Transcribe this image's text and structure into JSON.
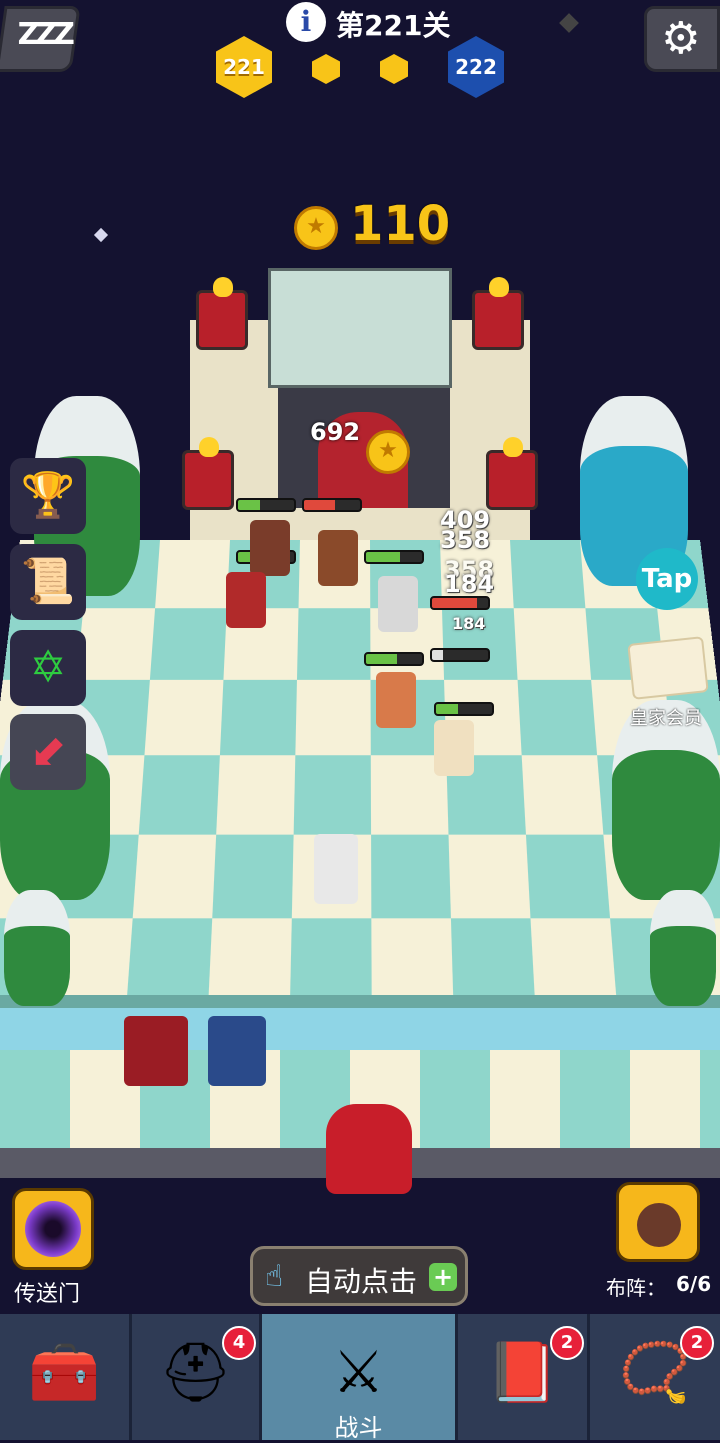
{
  "header": {
    "level_text": "第221关",
    "current_stage": "221",
    "next_stage": "222",
    "sleep_label": "ZZZ"
  },
  "battle": {
    "coin_total": "110",
    "gold_drop": "692",
    "damage_numbers": [
      "409",
      "358",
      "358",
      "184",
      "184"
    ]
  },
  "right_panel": {
    "tap_label": "Tap",
    "vip_label": "皇家会员"
  },
  "controls": {
    "portal_label": "传送门",
    "auto_click_label": "自动点击",
    "auto_click_plus": "+",
    "formation_label": "布阵：",
    "formation_count": "6/6"
  },
  "nav": {
    "tabs": [
      {
        "icon": "treasure-chest-icon",
        "badge": ""
      },
      {
        "icon": "viking-helmet-icon",
        "badge": "4"
      },
      {
        "icon": "crossed-swords-icon",
        "label": "战斗",
        "badge": ""
      },
      {
        "icon": "spellbook-icon",
        "badge": "2"
      },
      {
        "icon": "amulet-icon",
        "badge": "2"
      }
    ]
  },
  "colors": {
    "background": "#141230",
    "gold": "#f8c418",
    "teal_tile": "#8fd6cb",
    "blue_stage": "#1d4fae",
    "badge_red": "#e7203a"
  }
}
